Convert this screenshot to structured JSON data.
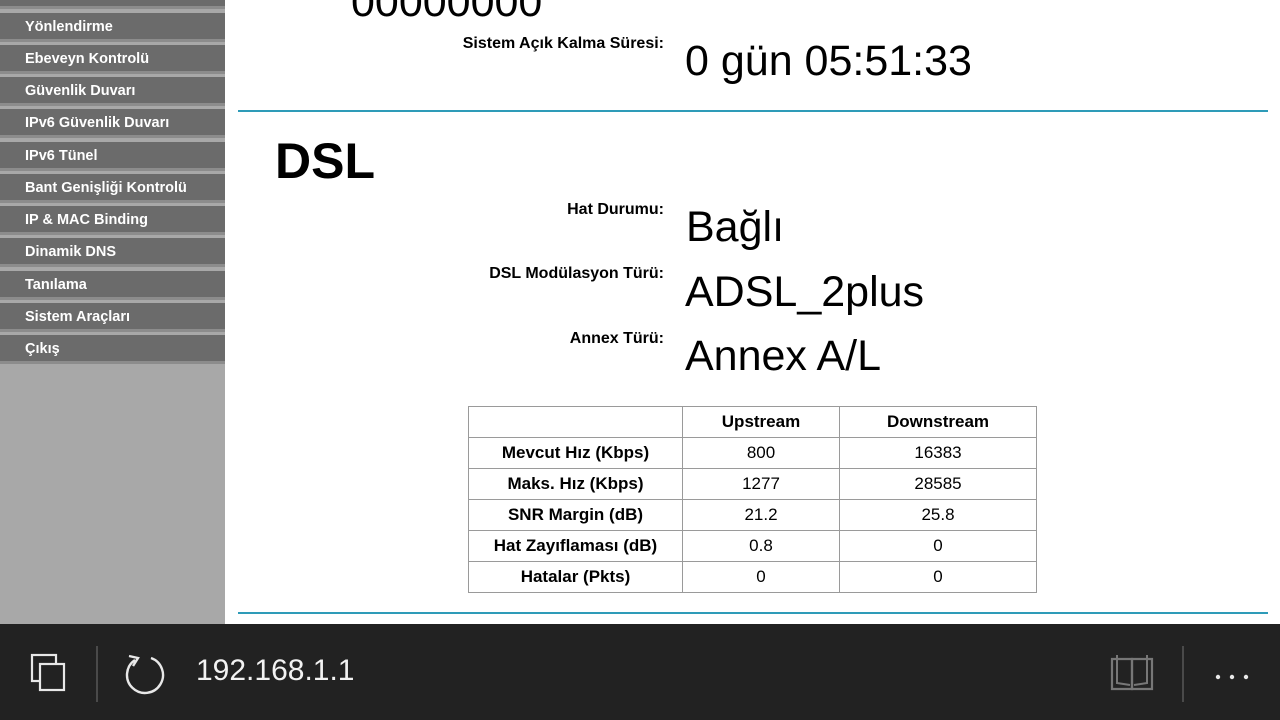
{
  "sidebar": {
    "items": [
      {
        "label": "Yönlendirme"
      },
      {
        "label": "Ebeveyn Kontrolü"
      },
      {
        "label": "Güvenlik Duvarı"
      },
      {
        "label": "IPv6 Güvenlik Duvarı"
      },
      {
        "label": "IPv6 Tünel"
      },
      {
        "label": "Bant Genişliği Kontrolü"
      },
      {
        "label": "IP & MAC Binding"
      },
      {
        "label": "Dinamik DNS"
      },
      {
        "label": "Tanılama"
      },
      {
        "label": "Sistem Araçları"
      },
      {
        "label": "Çıkış"
      }
    ]
  },
  "system": {
    "cut_value": "00000000",
    "uptime_label": "Sistem Açık Kalma Süresi:",
    "uptime_value": "0 gün 05:51:33"
  },
  "dsl": {
    "heading": "DSL",
    "line_status_label": "Hat Durumu:",
    "line_status_value": "Bağlı",
    "modulation_label": "DSL Modülasyon Türü:",
    "modulation_value": "ADSL_2plus",
    "annex_label": "Annex Türü:",
    "annex_value": "Annex A/L",
    "table": {
      "headers": [
        "",
        "Upstream",
        "Downstream"
      ],
      "rows": [
        {
          "label": "Mevcut Hız (Kbps)",
          "up": "800",
          "down": "16383"
        },
        {
          "label": "Maks. Hız (Kbps)",
          "up": "1277",
          "down": "28585"
        },
        {
          "label": "SNR Margin (dB)",
          "up": "21.2",
          "down": "25.8"
        },
        {
          "label": "Hat Zayıflaması (dB)",
          "up": "0.8",
          "down": "0"
        },
        {
          "label": "Hatalar (Pkts)",
          "up": "0",
          "down": "0"
        }
      ]
    }
  },
  "browser_bar": {
    "url": "192.168.1.1",
    "icons": [
      "tabs-icon",
      "refresh-icon",
      "reading-view-icon",
      "more-icon"
    ]
  },
  "colors": {
    "sidebar_item_bg": "#6b6b6b",
    "sidebar_bg": "#a8a8a8",
    "divider": "#2e9bb8",
    "bottom_bar_bg": "#222222"
  }
}
